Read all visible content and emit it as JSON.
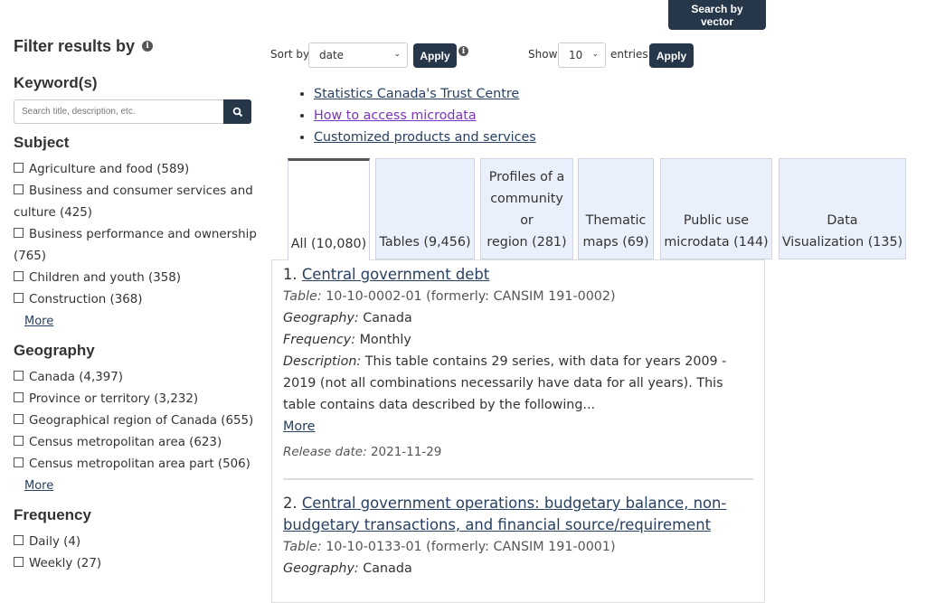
{
  "header": {
    "search_by_vector": "Search by vector"
  },
  "sidebar": {
    "title": "Filter results by",
    "keyword": {
      "heading": "Keyword(s)",
      "placeholder": "Search title, description, etc."
    },
    "subject": {
      "heading": "Subject",
      "items": [
        "Agriculture and food (589)",
        "Business and consumer services and culture (425)",
        "Business performance and ownership (765)",
        "Children and youth (358)",
        "Construction (368)"
      ],
      "more": "More"
    },
    "geography": {
      "heading": "Geography",
      "items": [
        "Canada (4,397)",
        "Province or territory (3,232)",
        "Geographical region of Canada (655)",
        "Census metropolitan area (623)",
        "Census metropolitan area part (506)"
      ],
      "more": "More"
    },
    "frequency": {
      "heading": "Frequency",
      "items": [
        "Daily (4)",
        "Weekly (27)"
      ]
    }
  },
  "toolbar": {
    "sort_label": "Sort by",
    "sort_value": "date",
    "apply": "Apply",
    "show_label": "Show",
    "show_value": "10",
    "entries_label": "entries"
  },
  "links": [
    "Statistics Canada's Trust Centre",
    "How to access microdata",
    "Customized products and services"
  ],
  "tabs": [
    {
      "lines": [
        "All (10,080)"
      ]
    },
    {
      "lines": [
        "Tables (9,456)"
      ]
    },
    {
      "lines": [
        "Profiles of a",
        "community",
        "or",
        "region (281)"
      ]
    },
    {
      "lines": [
        "Thematic",
        "maps (69)"
      ]
    },
    {
      "lines": [
        "Public use",
        "microdata (144)"
      ]
    },
    {
      "lines": [
        "Data",
        "Visualization (135)"
      ]
    }
  ],
  "results": [
    {
      "num": "1.",
      "title": "Central government debt",
      "table_label": "Table:",
      "table": "10-10-0002-01 (formerly: CANSIM 191-0002)",
      "geo_label": "Geography:",
      "geo": "Canada",
      "freq_label": "Frequency:",
      "freq": "Monthly",
      "desc_label": "Description:",
      "desc": "This table contains 29 series, with data for years 2009 - 2019 (not all combinations necessarily have data for all years). This table contains data described by the following...",
      "more": "More",
      "release_label": "Release date:",
      "release": "2021-11-29"
    },
    {
      "num": "2.",
      "title": "Central government operations: budgetary balance, non-budgetary transactions, and financial source/requirement",
      "table_label": "Table:",
      "table": "10-10-0133-01 (formerly: CANSIM 191-0001)",
      "geo_label": "Geography:",
      "geo": "Canada"
    }
  ]
}
